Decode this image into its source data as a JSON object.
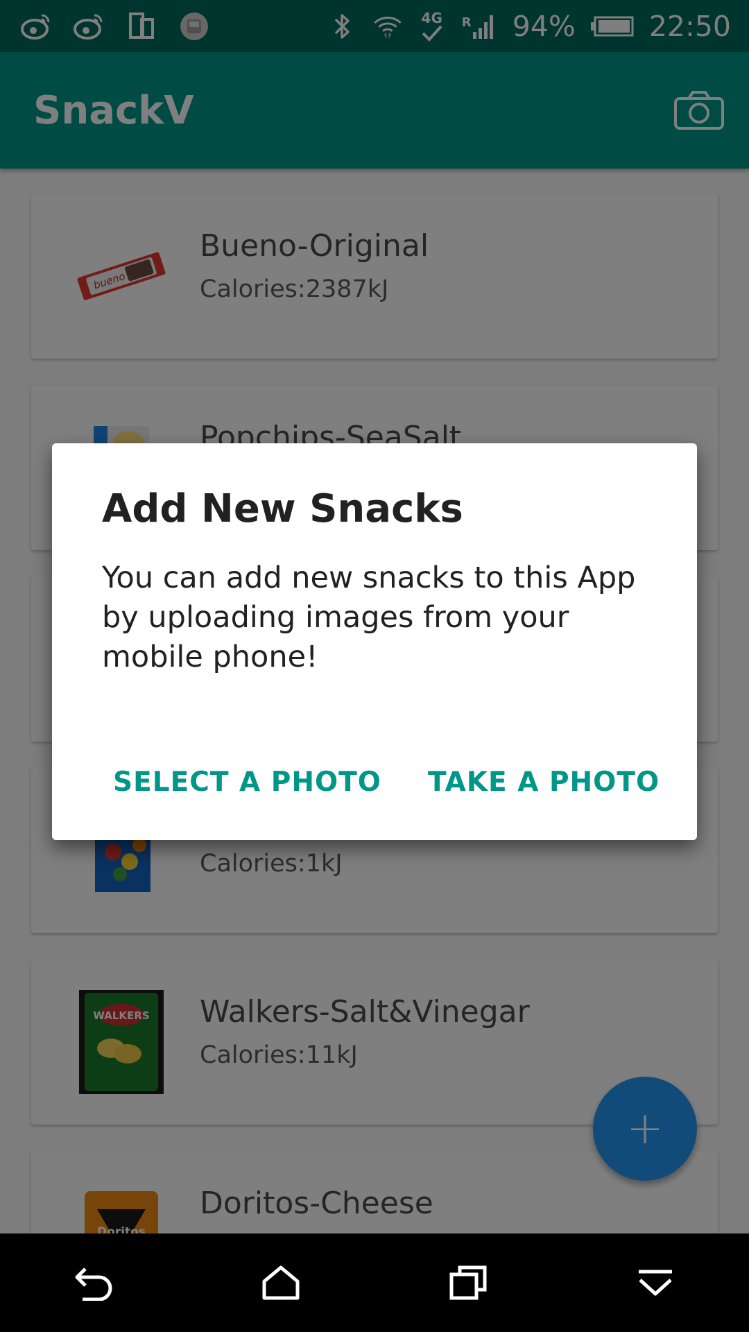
{
  "status_bar": {
    "icons_left": [
      "weibo-icon",
      "weibo-icon",
      "phone-rotate-icon",
      "app-notification-icon"
    ],
    "icons_right": [
      "bluetooth-icon",
      "wifi-icon",
      "4g-icon",
      "signal-icon"
    ],
    "network_label": "4G",
    "roaming_label": "R",
    "battery_percent": "94%",
    "time": "22:50"
  },
  "app_bar": {
    "title": "SnackV",
    "action_icon": "camera-icon"
  },
  "snacks": [
    {
      "name": "Bueno-Original",
      "calories": "Calories:2387kJ",
      "thumb": "bueno-thumbnail"
    },
    {
      "name": "Popchips-SeaSalt",
      "calories": "",
      "thumb": "popchips-thumbnail"
    },
    {
      "name": "",
      "calories": "",
      "thumb": ""
    },
    {
      "name": "",
      "calories": "Calories:1kJ",
      "thumb": "candy-bag-thumbnail"
    },
    {
      "name": "Walkers-Salt&Vinegar",
      "calories": "Calories:11kJ",
      "thumb": "walkers-thumbnail",
      "thumb_text": "WALKERS"
    },
    {
      "name": "Doritos-Cheese",
      "calories": "",
      "thumb": "doritos-thumbnail",
      "thumb_text": "Doritos"
    }
  ],
  "fab": {
    "label": "+"
  },
  "dialog": {
    "title": "Add New Snacks",
    "body": "You can add new snacks to this App by uploading images from your mobile phone!",
    "actions": {
      "select_label": "SELECT A PHOTO",
      "take_label": "TAKE A PHOTO"
    }
  },
  "nav_bar": {
    "icons": [
      "back-icon",
      "home-icon",
      "recents-icon",
      "notifications-pulldown-icon"
    ]
  },
  "colors": {
    "primary": "#009688",
    "primary_dark": "#00695c",
    "accent": "#2196f3",
    "dialog_button": "#009688"
  }
}
